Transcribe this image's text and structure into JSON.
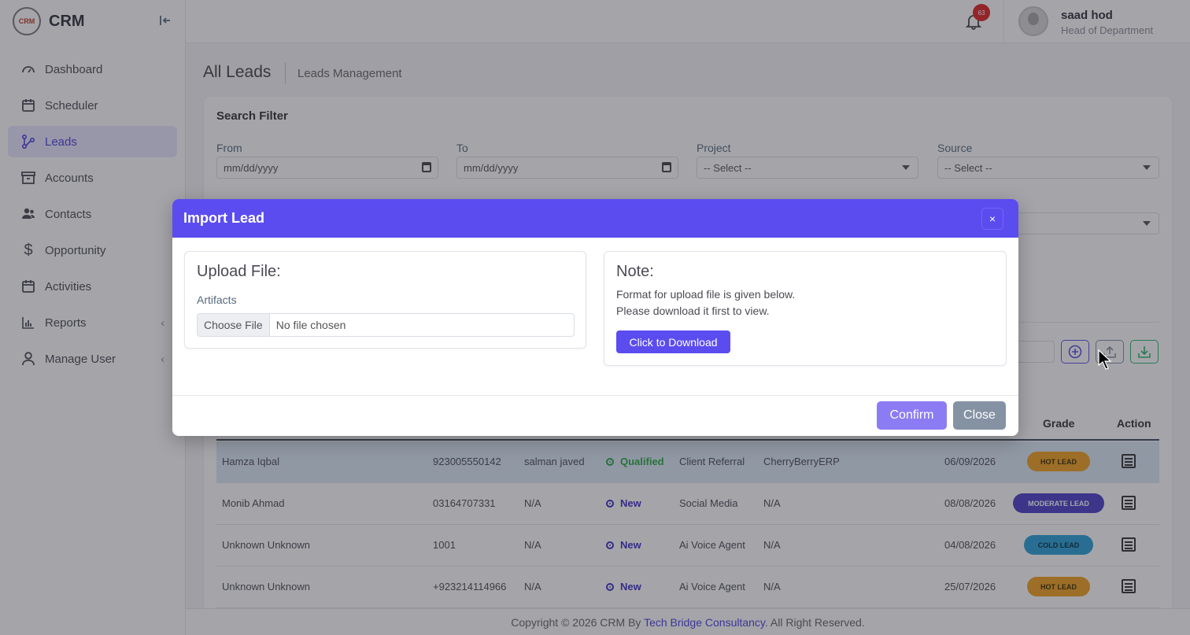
{
  "brand": {
    "name": "CRM",
    "logo_text": "CRM"
  },
  "sidebar": {
    "items": [
      {
        "label": "Dashboard",
        "icon": "gauge-icon"
      },
      {
        "label": "Scheduler",
        "icon": "calendar-icon"
      },
      {
        "label": "Leads",
        "icon": "leads-icon",
        "active": true
      },
      {
        "label": "Accounts",
        "icon": "archive-icon"
      },
      {
        "label": "Contacts",
        "icon": "contacts-icon"
      },
      {
        "label": "Opportunity",
        "icon": "dollar-icon"
      },
      {
        "label": "Activities",
        "icon": "calendar-icon"
      },
      {
        "label": "Reports",
        "icon": "bar-chart-icon",
        "has_submenu": true
      },
      {
        "label": "Manage User",
        "icon": "user-icon",
        "has_submenu": true
      }
    ]
  },
  "topbar": {
    "notification_count": "63",
    "user_name": "saad hod",
    "user_role": "Head of Department"
  },
  "page": {
    "title": "All Leads",
    "subtitle": "Leads Management"
  },
  "filter": {
    "title": "Search Filter",
    "from_label": "From",
    "from_value": "mm/dd/yyyy",
    "to_label": "To",
    "to_value": "mm/dd/yyyy",
    "project_label": "Project",
    "project_value": "-- Select --",
    "source_label": "Source",
    "source_value": "-- Select --"
  },
  "table": {
    "headers": {
      "grade": "Grade",
      "action": "Action"
    },
    "rows": [
      {
        "name": "Hamza Iqbal",
        "phone": "923005550142",
        "assigned": "salman javed",
        "status": "Qualified",
        "status_color": "#28a745",
        "source": "Client Referral",
        "project": "CherryBerryERP",
        "date": "06/09/2026",
        "grade": "HOT LEAD",
        "grade_color": "#f0a020",
        "highlight": true
      },
      {
        "name": "Monib Ahmad",
        "phone": "03164707331",
        "assigned": "N/A",
        "status": "New",
        "status_color": "#3b2fc9",
        "source": "Social Media",
        "project": "N/A",
        "date": "08/08/2026",
        "grade": "MODERATE LEAD",
        "grade_color": "#4b3fc9"
      },
      {
        "name": "Unknown Unknown",
        "phone": "1001",
        "assigned": "N/A",
        "status": "New",
        "status_color": "#3b2fc9",
        "source": "Ai Voice Agent",
        "project": "N/A",
        "date": "04/08/2026",
        "grade": "COLD LEAD",
        "grade_color": "#2aa0d8"
      },
      {
        "name": "Unknown Unknown",
        "phone": "+923214114966",
        "assigned": "N/A",
        "status": "New",
        "status_color": "#3b2fc9",
        "source": "Ai Voice Agent",
        "project": "N/A",
        "date": "25/07/2026",
        "grade": "HOT LEAD",
        "grade_color": "#f0a020"
      }
    ]
  },
  "footer": {
    "prefix": "Copyright © 2026 CRM By ",
    "link": "Tech Bridge Consultancy",
    "suffix": ". All Right Reserved."
  },
  "modal": {
    "title": "Import Lead",
    "close_x": "×",
    "upload_heading": "Upload File:",
    "artifacts_label": "Artifacts",
    "choose_file": "Choose File",
    "no_file": "No file chosen",
    "note_heading": "Note:",
    "note_line1": "Format for upload file is given below.",
    "note_line2": "Please download it first to view.",
    "download_button": "Click to Download",
    "confirm_button": "Confirm",
    "close_button": "Close"
  }
}
